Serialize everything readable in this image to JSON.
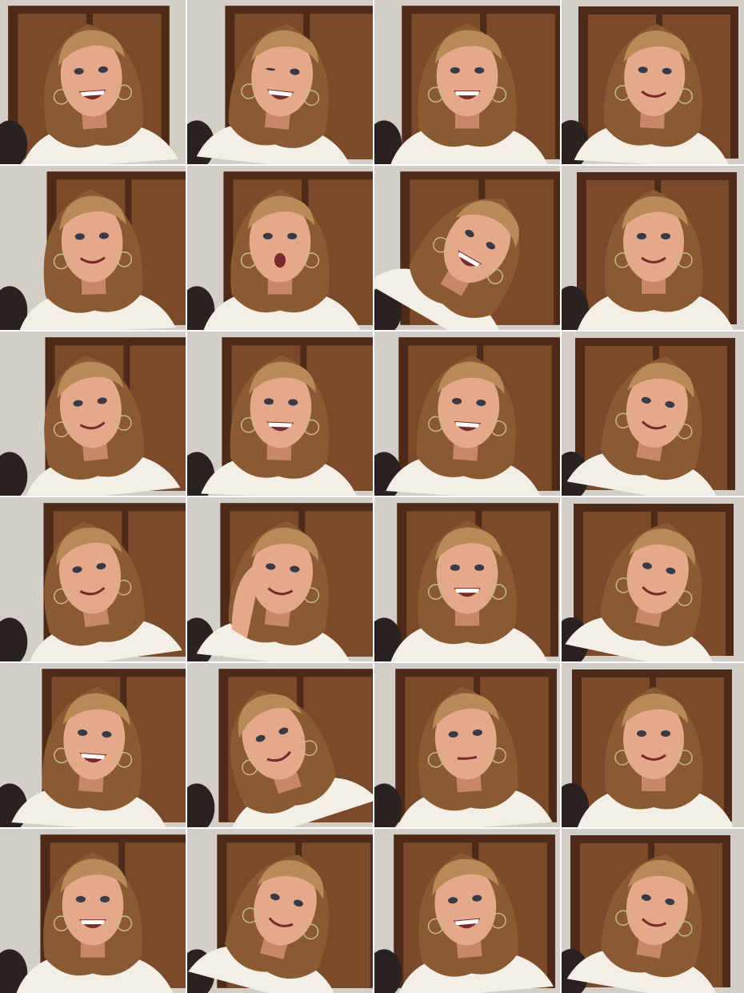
{
  "image": {
    "description_type": "photo-contact-sheet",
    "grid": {
      "columns": 4,
      "rows": 6
    },
    "palette": {
      "wall": "#d3cfc8",
      "door_dark": "#4e2a18",
      "door_wood": "#7a4a2a",
      "hair": "#8a5a32",
      "hair_light": "#b98a58",
      "skin": "#e3a98a",
      "skin_shade": "#c9876a",
      "jacket": "#f3efe6",
      "crowd": "#2a2220",
      "mouth": "#7a2a2a",
      "teeth": "#ffffff"
    },
    "tiles": [
      {
        "expr": "big-smile",
        "tilt": -4
      },
      {
        "expr": "wink-laugh",
        "tilt": 6
      },
      {
        "expr": "grin",
        "tilt": 0
      },
      {
        "expr": "smirk",
        "tilt": 3
      },
      {
        "expr": "smile",
        "tilt": -2
      },
      {
        "expr": "surprised",
        "tilt": 0
      },
      {
        "expr": "laugh-head-back",
        "tilt": 30
      },
      {
        "expr": "smile",
        "tilt": 0
      },
      {
        "expr": "smirk",
        "tilt": -6
      },
      {
        "expr": "laugh",
        "tilt": 2
      },
      {
        "expr": "grimace",
        "tilt": 4
      },
      {
        "expr": "smirk",
        "tilt": 10
      },
      {
        "expr": "smile",
        "tilt": -8
      },
      {
        "expr": "hand-on-face",
        "tilt": 6
      },
      {
        "expr": "laugh",
        "tilt": 0
      },
      {
        "expr": "smirk",
        "tilt": 12
      },
      {
        "expr": "laugh",
        "tilt": 4
      },
      {
        "expr": "coy",
        "tilt": -18
      },
      {
        "expr": "neutral",
        "tilt": -4
      },
      {
        "expr": "smile",
        "tilt": 0
      },
      {
        "expr": "big-smile",
        "tilt": 0
      },
      {
        "expr": "coy-smile",
        "tilt": 15
      },
      {
        "expr": "grin",
        "tilt": -5
      },
      {
        "expr": "smile",
        "tilt": 10
      }
    ]
  }
}
